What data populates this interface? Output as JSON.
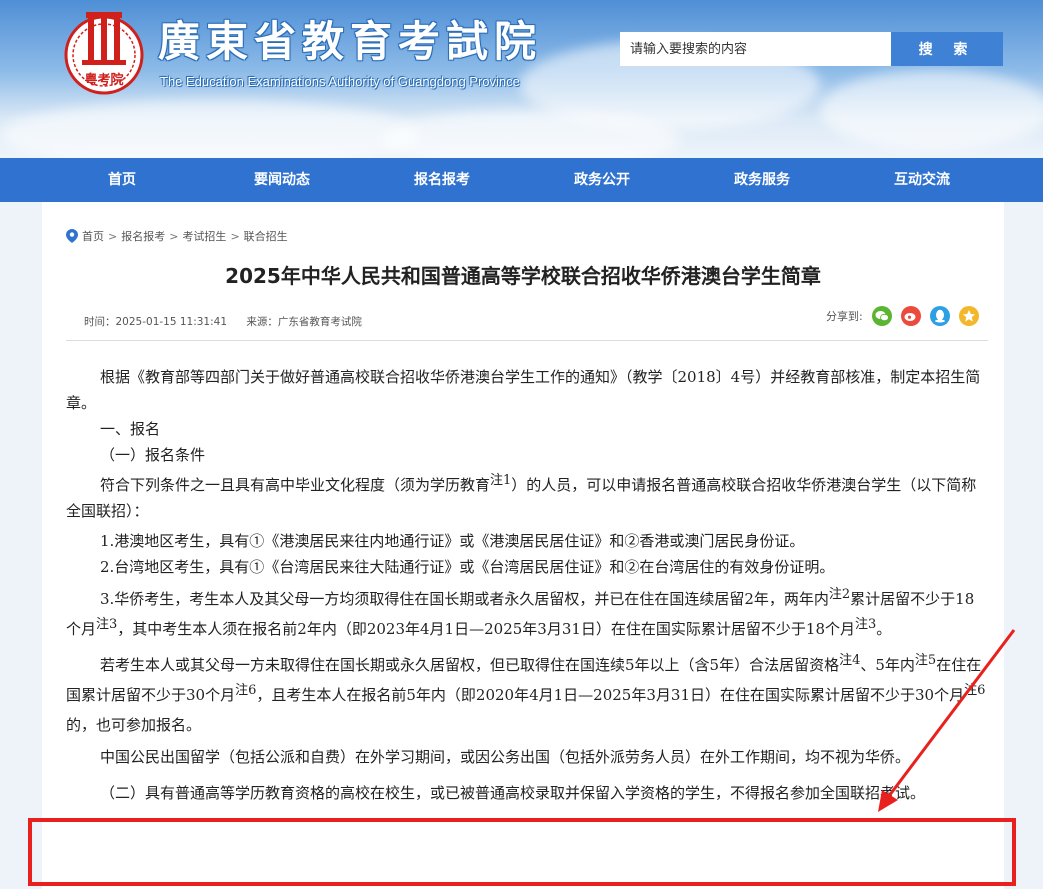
{
  "header": {
    "site_title": "廣東省教育考試院",
    "site_subtitle": "The Education Examinations Authority of Guangdong Province",
    "logo_text": "粤考院",
    "search_placeholder": "请输入要搜索的内容",
    "search_button": "搜 索"
  },
  "nav": [
    {
      "label": "首页"
    },
    {
      "label": "要闻动态"
    },
    {
      "label": "报名报考"
    },
    {
      "label": "政务公开"
    },
    {
      "label": "政务服务"
    },
    {
      "label": "互动交流"
    }
  ],
  "breadcrumb": {
    "items": [
      "首页",
      "报名报考",
      "考试招生",
      "联合招生"
    ],
    "separator": ">"
  },
  "article": {
    "title": "2025年中华人民共和国普通高等学校联合招收华侨港澳台学生简章",
    "time": "时间：2025-01-15 11:31:41",
    "source": "来源：广东省教育考试院",
    "share_label": "分享到:",
    "share_icons": [
      "wechat-icon",
      "weibo-icon",
      "qq-icon",
      "qzone-icon"
    ],
    "p1": "根据《教育部等四部门关于做好普通高校联合招收华侨港澳台学生工作的通知》（教学〔2018〕4号）并经教育部核准，制定本招生简章。",
    "p2": "一、报名",
    "p3": "（一）报名条件",
    "p4a": "符合下列条件之一且具有高中毕业文化程度（须为学历教育",
    "note1": "注1",
    "p4b": "）的人员，可以申请报名普通高校联合招收华侨港澳台学生（以下简称全国联招）：",
    "p5": "1.港澳地区考生，具有①《港澳居民来往内地通行证》或《港澳居民居住证》和②香港或澳门居民身份证。",
    "p6": "2.台湾地区考生，具有①《台湾居民来往大陆通行证》或《台湾居民居住证》和②在台湾居住的有效身份证明。",
    "p7a": "3.华侨考生，考生本人及其父母一方均须取得住在国长期或者永久居留权，并已在住在国连续居留2年，两年内",
    "note2": "注2",
    "p7b": "累计居留不少于18个月",
    "note3": "注3",
    "p7c": "，其中考生本人须在报名前2年内（即2023年4月1日—2025年3月31日）在住在国实际累计居留不少于18个月",
    "p7d": "。",
    "p8a": "若考生本人或其父母一方未取得住在国长期或永久居留权，但已取得住在国连续5年以上（含5年）合法居留资格",
    "note4": "注4",
    "p8b": "、5年内",
    "note5": "注5",
    "p8c": "在住在国累计居留不少于30个月",
    "note6": "注6",
    "p8d": "，且考生本人在报名前5年内（即2020年4月1日—2025年3月31日）在住在国实际累计居留不少于30个月",
    "p8e": "的，也可参加报名。",
    "p9": "中国公民出国留学（包括公派和自费）在外学习期间，或因公务出国（包括外派劳务人员）在外工作期间，均不视为华侨。",
    "p10": "（二）具有普通高等学历教育资格的高校在校生，或已被普通高校录取并保留入学资格的学生，不得报名参加全国联招考试。"
  },
  "colors": {
    "nav_bg": "#2f72cf",
    "search_button_bg": "#3f82d5",
    "highlight_red": "#e8201e"
  }
}
